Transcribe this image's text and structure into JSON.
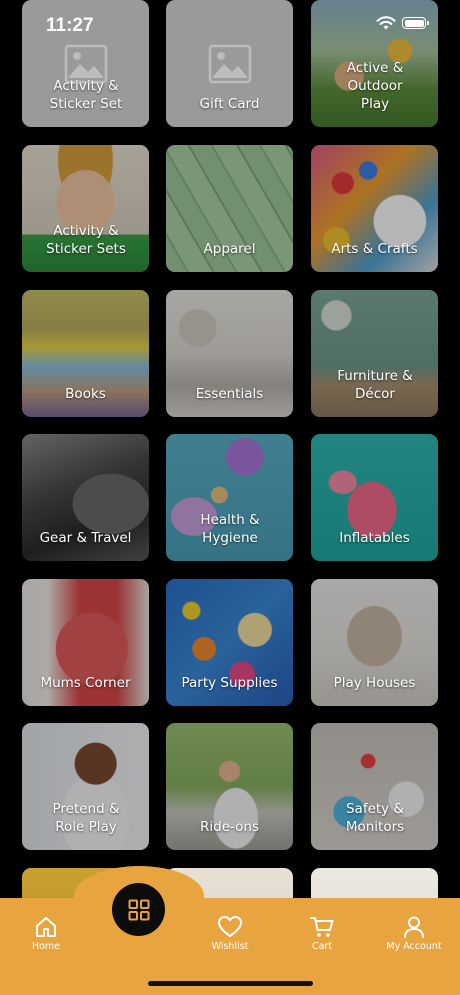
{
  "status_bar": {
    "time": "11:27"
  },
  "categories": [
    {
      "label": "Activity & Sticker Set",
      "image": "placeholder"
    },
    {
      "label": "Gift Card",
      "image": "placeholder"
    },
    {
      "label": "Active & Outdoor Play",
      "image": "photo"
    },
    {
      "label": "Activity & Sticker Sets",
      "image": "photo"
    },
    {
      "label": "Apparel",
      "image": "photo"
    },
    {
      "label": "Arts & Crafts",
      "image": "photo"
    },
    {
      "label": "Books",
      "image": "photo"
    },
    {
      "label": "Essentials",
      "image": "photo"
    },
    {
      "label": "Furniture & Décor",
      "image": "photo"
    },
    {
      "label": "Gear & Travel",
      "image": "photo"
    },
    {
      "label": "Health & Hygiene",
      "image": "photo"
    },
    {
      "label": "Inflatables",
      "image": "photo"
    },
    {
      "label": "Mums Corner",
      "image": "photo"
    },
    {
      "label": "Party Supplies",
      "image": "photo"
    },
    {
      "label": "Play Houses",
      "image": "photo"
    },
    {
      "label": "Pretend & Role Play",
      "image": "photo"
    },
    {
      "label": "Ride-ons",
      "image": "photo"
    },
    {
      "label": "Safety & Monitors",
      "image": "photo"
    }
  ],
  "tab_bar": {
    "home": "Home",
    "wishlist": "Wishlist",
    "cart": "Cart",
    "account": "My Account",
    "accent_color": "#e8a43f"
  }
}
